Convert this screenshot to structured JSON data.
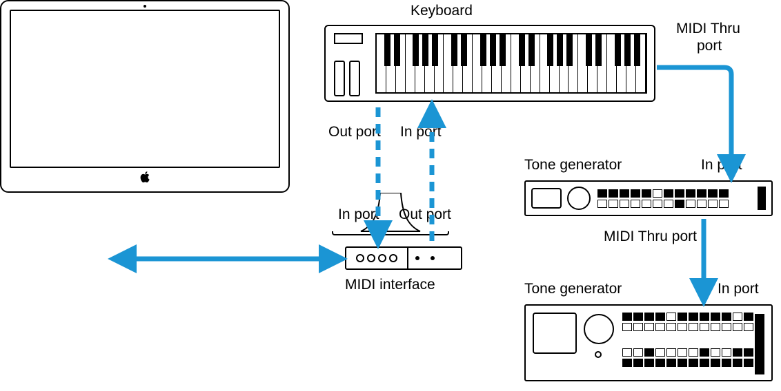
{
  "labels": {
    "computer": "Computer",
    "keyboard": "Keyboard",
    "midi_thru_port_1": "MIDI Thru",
    "midi_thru_port_1b": "port",
    "out_port_1": "Out port",
    "in_port_1": "In port",
    "in_port_2": "In port",
    "out_port_2": "Out port",
    "midi_interface": "MIDI interface",
    "tone_generator_1": "Tone generator",
    "in_port_3": "In port",
    "midi_thru_port_2": "MIDI Thru port",
    "tone_generator_2": "Tone generator",
    "in_port_4": "In port"
  },
  "connections": [
    {
      "from": "computer",
      "to": "midi-interface",
      "type": "bidirectional",
      "style": "solid"
    },
    {
      "from": "keyboard.out",
      "to": "midi-interface.in",
      "type": "unidirectional",
      "style": "dashed"
    },
    {
      "from": "midi-interface.out",
      "to": "keyboard.in",
      "type": "unidirectional",
      "style": "dashed"
    },
    {
      "from": "keyboard.thru",
      "to": "tone-generator-1.in",
      "type": "unidirectional",
      "style": "solid"
    },
    {
      "from": "tone-generator-1.thru",
      "to": "tone-generator-2.in",
      "type": "unidirectional",
      "style": "solid"
    }
  ]
}
